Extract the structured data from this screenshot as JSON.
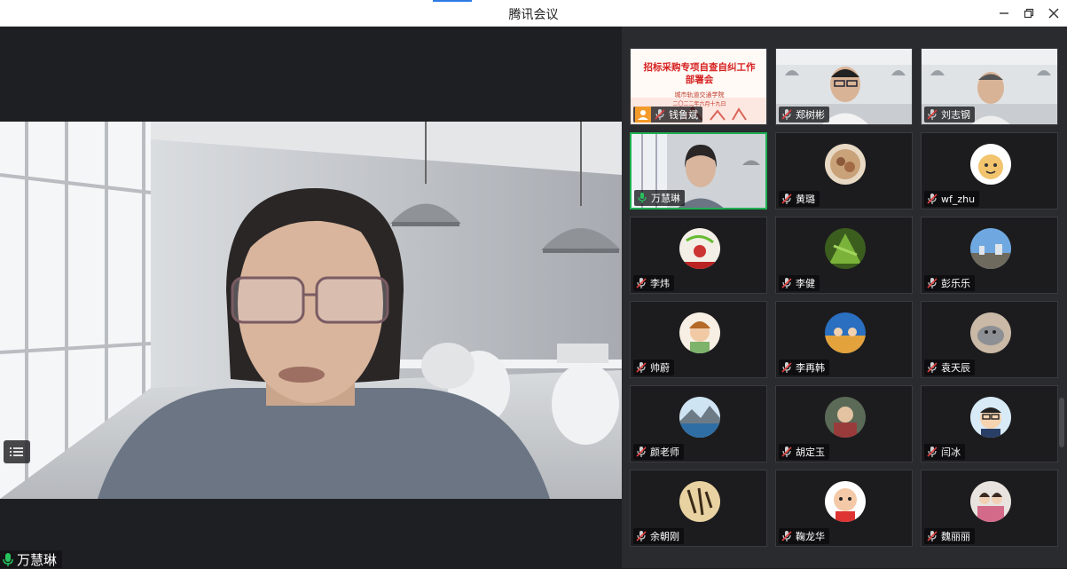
{
  "window": {
    "title": "腾讯会议"
  },
  "controls": {
    "minimize_icon": "minimize-icon",
    "restore_icon": "restore-icon",
    "close_icon": "close-icon"
  },
  "main": {
    "speaker_name": "万慧琳"
  },
  "slide": {
    "title_line1": "招标采购专项自查自纠工作",
    "title_line2": "部署会",
    "org": "城市轨道交通学院",
    "date": "二〇二二年六月十九日"
  },
  "participants": [
    {
      "name": "钱鲁斌",
      "type": "screen-share",
      "muted": true
    },
    {
      "name": "郑树彬",
      "type": "video",
      "muted": true
    },
    {
      "name": "刘志钢",
      "type": "video",
      "muted": true
    },
    {
      "name": "万慧琳",
      "type": "video",
      "muted": false,
      "speaking": true
    },
    {
      "name": "黄璐",
      "type": "avatar",
      "muted": true
    },
    {
      "name": "wf_zhu",
      "type": "avatar",
      "muted": true
    },
    {
      "name": "李炜",
      "type": "avatar",
      "muted": true
    },
    {
      "name": "李健",
      "type": "avatar",
      "muted": true
    },
    {
      "name": "彭乐乐",
      "type": "avatar",
      "muted": true
    },
    {
      "name": "帅蔚",
      "type": "avatar",
      "muted": true
    },
    {
      "name": "李再韩",
      "type": "avatar",
      "muted": true
    },
    {
      "name": "袁天辰",
      "type": "avatar",
      "muted": true
    },
    {
      "name": "颜老师",
      "type": "avatar",
      "muted": true
    },
    {
      "name": "胡定玉",
      "type": "avatar",
      "muted": true
    },
    {
      "name": "闫冰",
      "type": "avatar",
      "muted": true
    },
    {
      "name": "余朝刚",
      "type": "avatar",
      "muted": true
    },
    {
      "name": "鞠龙华",
      "type": "avatar",
      "muted": true
    },
    {
      "name": "魏丽丽",
      "type": "avatar",
      "muted": true
    }
  ],
  "colors": {
    "accent": "#2c7be5",
    "speaking": "#1fae52",
    "muted": "#e03e3e",
    "panel": "#2a2b2e"
  }
}
